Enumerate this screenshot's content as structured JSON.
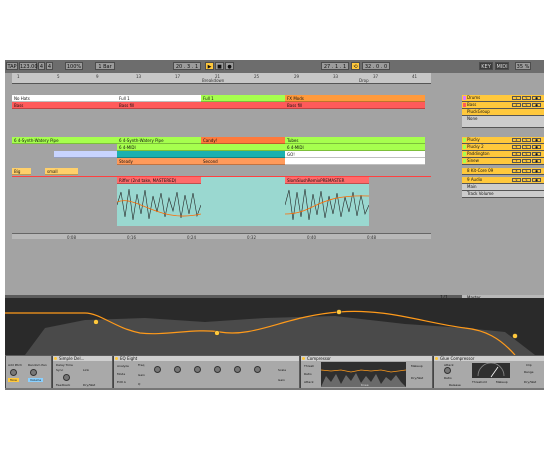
{
  "toolbar": {
    "tap": "TAP",
    "tempo": "123.00",
    "sig_num": "4",
    "sig_den": "4",
    "zoom": "100%",
    "quant": "1 Bar",
    "pos": "20 . 3 . 1",
    "loop_start": "27 . 1 . 1",
    "loop_len": "32 . 0 . 0",
    "key": "KEY",
    "midi": "MIDI",
    "cpu": "35 %"
  },
  "ruler": {
    "bars": [
      "1",
      "5",
      "9",
      "13",
      "17",
      "21",
      "25",
      "29",
      "33",
      "37",
      "41"
    ],
    "markers": [
      "Breakdown",
      "Drop"
    ],
    "times": [
      "0:08",
      "0:16",
      "0:24",
      "0:32",
      "0:40",
      "0:48",
      "0:56",
      "1:04"
    ]
  },
  "clips": [
    {
      "label": "No Hats",
      "color": "#ffffff"
    },
    {
      "label": "Full 1",
      "color": "#ffffff"
    },
    {
      "label": "Full 1",
      "color": "#ffffff"
    },
    {
      "label": "FX Mods",
      "color": "#ffffff"
    },
    {
      "label": "Bass",
      "color": "#ff5a5a"
    },
    {
      "label": "Bass fill",
      "color": "#ff5a5a"
    },
    {
      "label": "Bass fill",
      "color": "#ff5a5a"
    },
    {
      "label": "6 4-Synth-Watery Pipe",
      "color": "#a6ff4e"
    },
    {
      "label": "6 4-Synth-Watery Pipe",
      "color": "#a6ff4e"
    },
    {
      "label": "Candy!",
      "color": "#ff7a3c"
    },
    {
      "label": "Tubes",
      "color": "#a6ff4e"
    },
    {
      "label": "6 4-MIDI",
      "color": "#a6ff4e"
    },
    {
      "label": "6 4-MIDI",
      "color": "#a6ff4e"
    },
    {
      "label": "GO!",
      "color": "#ffffff"
    },
    {
      "label": "Steady",
      "color": "#ff9a5a"
    },
    {
      "label": "Second",
      "color": "#ff9a5a"
    },
    {
      "label": "Big",
      "color": "#ffd06a"
    },
    {
      "label": "small",
      "color": "#ffd06a"
    },
    {
      "label": "Riffer (2nd take, MASTERED)",
      "color": "#ff6a6a"
    },
    {
      "label": "SlomSlushRemixPREMASTER",
      "color": "#ff6a6a"
    }
  ],
  "tracks": [
    {
      "name": "Drums",
      "color": "#e07aff"
    },
    {
      "name": "Bass",
      "color": "#ff5a5a"
    },
    {
      "name": "PluckGroup",
      "color": "#ffc83c"
    },
    {
      "name": "None",
      "color": "#cccccc"
    },
    {
      "name": "Plucky",
      "color": "#a6ff4e"
    },
    {
      "name": "Plucky 2",
      "color": "#a6ff4e"
    },
    {
      "name": "Paddington",
      "color": "#a6ff4e"
    },
    {
      "name": "Sinew",
      "color": "#a6ff4e"
    },
    {
      "name": "8 Kit-Core 09",
      "color": "#ffc83c"
    },
    {
      "name": "9 Audio",
      "color": "#ffc83c"
    },
    {
      "name": "Main",
      "color": "#cccccc"
    },
    {
      "name": "Track Volume",
      "color": "#cccccc"
    },
    {
      "name": "Master",
      "color": "#cccccc"
    }
  ],
  "master_fraction": "1/1",
  "devices": [
    {
      "name": "Simple Del...",
      "labels": [
        "Delay Time",
        "Sync",
        "Link",
        "Feedback",
        "Dry/Wet",
        "Time"
      ]
    },
    {
      "name": "EQ Eight",
      "labels": [
        "Analyze",
        "Mode",
        "Edit A",
        "Freq",
        "Gain",
        "Q",
        "Scale",
        "Gain"
      ]
    },
    {
      "name": "Compressor",
      "labels": [
        "Thresh",
        "Ratio",
        "Attack",
        "Release",
        "Out",
        "Makeup",
        "Dry/Wet",
        "Knee"
      ]
    },
    {
      "name": "Glue Compressor",
      "labels": [
        "Attack",
        "Ratio",
        "Threshold",
        "Makeup",
        "Release",
        "Range",
        "Dry/Wet",
        "Clip"
      ]
    }
  ],
  "pre_device": {
    "labels": [
      "Add Pitch",
      "Random Pan",
      "Tone",
      "Volume"
    ]
  },
  "colors": {
    "accent": "#ffc83c",
    "eq_curve": "#ff9a1a"
  }
}
